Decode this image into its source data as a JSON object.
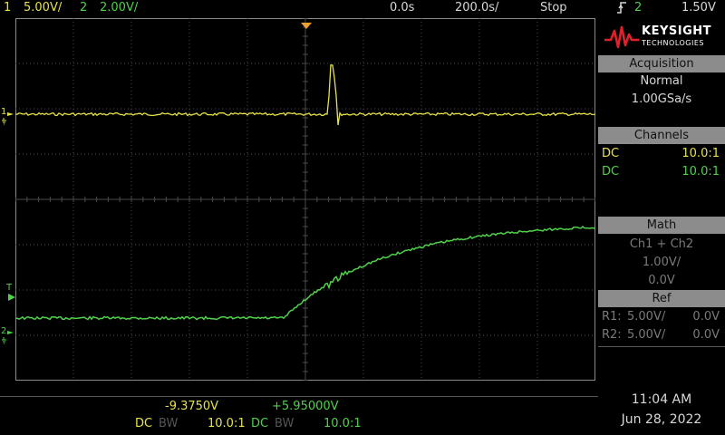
{
  "colors": {
    "ch1": "#e6e24a",
    "ch2": "#4fd14a",
    "trigger": "#f0a030",
    "grid": "#4a4a4a",
    "panel_header": "#8c8c8c",
    "logo_red": "#e0202a"
  },
  "header": {
    "ch1_num": "1",
    "ch1_scale": "5.00V/",
    "ch2_num": "2",
    "ch2_scale": "2.00V/",
    "time_delay": "0.0s",
    "time_scale": "200.0s/",
    "run_state": "Stop",
    "trigger_icon": "trigger-edge-icon",
    "trigger_source": "2",
    "trigger_level": "1.50V"
  },
  "markers": {
    "ch1": "1",
    "ch2": "2",
    "trigger": "T"
  },
  "logo": {
    "brand": "KEYSIGHT",
    "sub": "TECHNOLOGIES",
    "icon": "keysight-wave-icon"
  },
  "acquisition": {
    "title": "Acquisition",
    "mode": "Normal",
    "rate": "1.00GSa/s"
  },
  "channels": {
    "title": "Channels",
    "items": [
      {
        "coupling": "DC",
        "probe": "10.0:1"
      },
      {
        "coupling": "DC",
        "probe": "10.0:1"
      }
    ]
  },
  "math": {
    "title": "Math",
    "function": "Ch1 + Ch2",
    "scale": "1.00V/",
    "offset": "0.0V"
  },
  "ref": {
    "title": "Ref",
    "items": [
      {
        "name": "R1:",
        "scale": "5.00V/",
        "offset": "0.0V"
      },
      {
        "name": "R2:",
        "scale": "5.00V/",
        "offset": "0.0V"
      }
    ]
  },
  "measurements": {
    "ch1_offset": "-9.3750V",
    "ch2_offset": "+5.95000V",
    "ch1": {
      "coupling": "DC",
      "bw": "BW",
      "probe": "10.0:1"
    },
    "ch2": {
      "coupling": "DC",
      "bw": "BW",
      "probe": "10.0:1"
    }
  },
  "clock": {
    "time": "11:04 AM",
    "date": "Jun 28, 2022"
  }
}
